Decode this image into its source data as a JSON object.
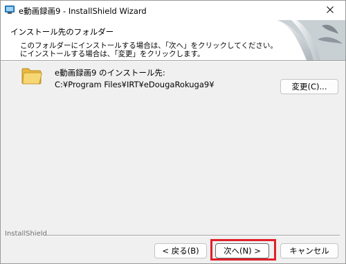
{
  "window": {
    "title": "e動画録画9 - InstallShield Wizard",
    "close_label": "×"
  },
  "header": {
    "title": "インストール先のフォルダー",
    "description_line1": "このフォルダーにインストールする場合は、「次へ」をクリックしてください。別のフォルダ",
    "description_line2": "にインストールする場合は、「変更」をクリックします。"
  },
  "destination": {
    "label": "e動画録画9 のインストール先:",
    "path": "C:¥Program Files¥IRT¥eDougaRokuga9¥",
    "change_button_label": "変更(C)...",
    "folder_icon": "folder-icon"
  },
  "footer": {
    "brand": "InstallShield",
    "back_button_label": "< 戻る(B)",
    "next_button_label": "次へ(N) >",
    "cancel_button_label": "キャンセル"
  },
  "colors": {
    "highlight": "#e0202a",
    "window_bg": "#f0f0f0",
    "folder": "#f2c94c"
  }
}
